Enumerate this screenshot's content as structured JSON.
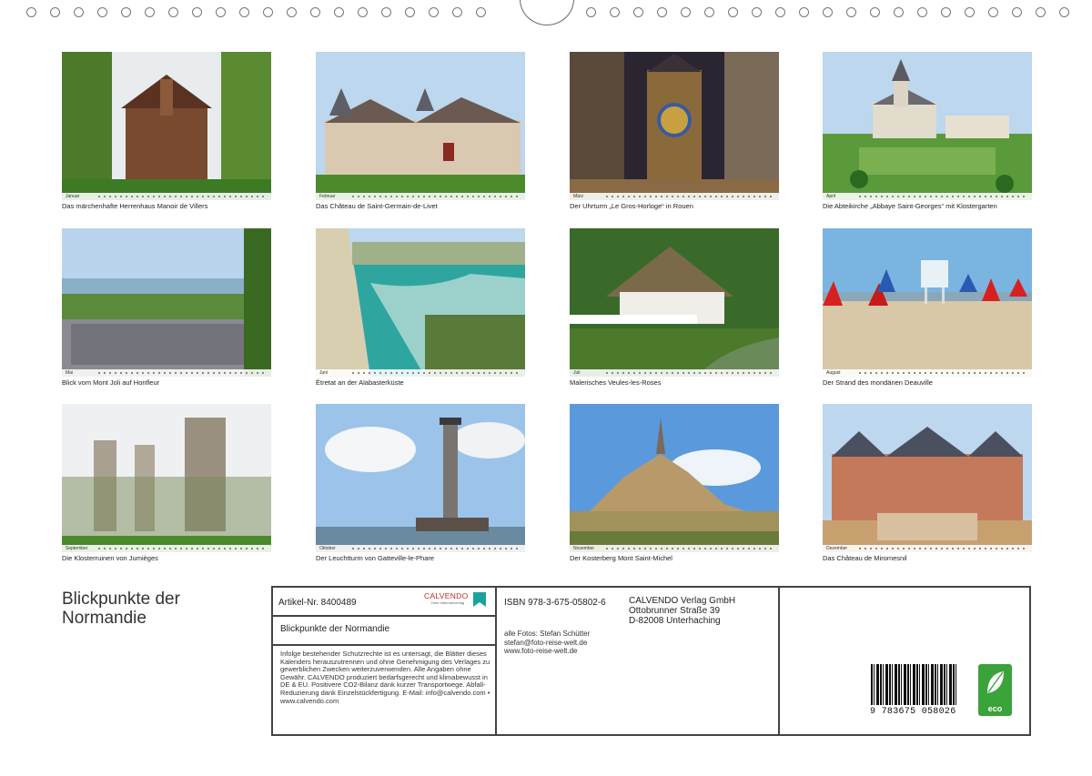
{
  "calendar": {
    "title_lines": [
      "Blickpunkte der",
      "Normandie"
    ],
    "months": [
      {
        "name": "Januar",
        "caption": "Das märchenhafte Herrenhaus Manoir de Villers",
        "scene": "manor"
      },
      {
        "name": "Februar",
        "caption": "Das Château de Saint-Germain-de-Livet",
        "scene": "chateau"
      },
      {
        "name": "März",
        "caption": "Der Uhrturm „Le Gros-Horloge“ in Rouen",
        "scene": "clock"
      },
      {
        "name": "April",
        "caption": "Die Abteikirche „Abbaye Saint-Georges“ mit Klostergarten",
        "scene": "abbey"
      },
      {
        "name": "Mai",
        "caption": "Blick vom Mont Joli auf Honfleur",
        "scene": "town"
      },
      {
        "name": "Juni",
        "caption": "Étretat an der Alabasterküste",
        "scene": "cliff"
      },
      {
        "name": "Juli",
        "caption": "Malerisches Veules-les-Roses",
        "scene": "cottage"
      },
      {
        "name": "August",
        "caption": "Der Strand des mondänen Deauville",
        "scene": "beach"
      },
      {
        "name": "September",
        "caption": "Die Klosterruinen von Jumièges",
        "scene": "ruins"
      },
      {
        "name": "Oktober",
        "caption": "Der Leuchtturm von Gatteville-le-Phare",
        "scene": "lighthouse"
      },
      {
        "name": "November",
        "caption": "Der Kosterberg Mont Saint-Michel",
        "scene": "mont"
      },
      {
        "name": "Dezember",
        "caption": "Das Château de Miromesnil",
        "scene": "palace"
      }
    ]
  },
  "imprint": {
    "article": "Artikel-Nr. 8400489",
    "brand": "CALVENDO",
    "brand_sub": "Dein Kalenderverlag",
    "product_title": "Blickpunkte der Normandie",
    "legal_text": "Infolge bestehender Schutzrechte ist es untersagt, die Blätter dieses Kalenders herauszutrennen und ohne Genehmigung des Verlages zu gewerblichen Zwecken weiterzuverwenden. Alle Angaben ohne Gewähr. CALVENDO produziert bedarfsgerecht und klimabewusst in DE & EU. Positivere CO2-Bilanz dank kurzer Transportwege. Abfall-Reduzierung dank Einzelstückfertigung. E-Mail: info@calvendo.com • www.calvendo.com",
    "isbn": "ISBN 978-3-675-05802-6",
    "publisher_lines": [
      "CALVENDO Verlag GmbH",
      "Ottobrunner Straße 39",
      "D-82008 Unterhaching"
    ],
    "photo_credit_lines": [
      "alle Fotos: Stefan Schütter",
      "stefan@foto-reise-welt.de",
      "www.foto-reise-welt.de"
    ],
    "barcode_number": "9 783675 058026",
    "eco_label": "eco"
  },
  "colors": {
    "border": "#444444",
    "eco_green": "#3aa33a",
    "calvendo_teal": "#1aa39a"
  }
}
